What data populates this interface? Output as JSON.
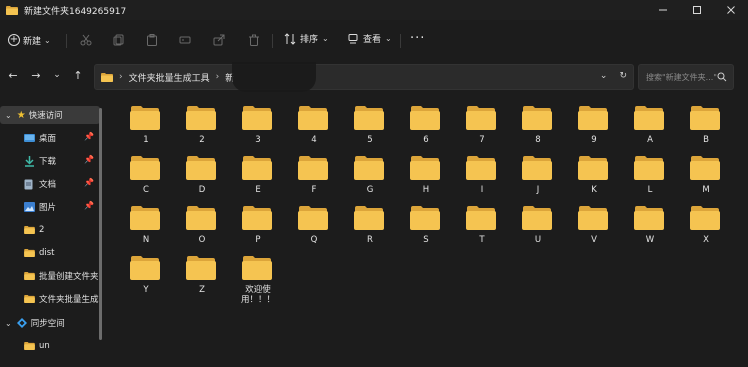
{
  "window": {
    "title": "新建文件夹1649265917",
    "controls": [
      "minimize",
      "maximize",
      "close"
    ]
  },
  "toolbar": {
    "new_label": "新建",
    "sort_label": "排序",
    "view_label": "查看",
    "more_label": "···",
    "icons": [
      "cut-icon",
      "copy-icon",
      "paste-icon",
      "rename-icon",
      "share-icon",
      "delete-icon"
    ]
  },
  "nav": {
    "back": "←",
    "forward": "→",
    "recent": "⌄",
    "up": "↑"
  },
  "address": {
    "segments": [
      "文件夹批量生成工具",
      "新"
    ],
    "refresh": "↻",
    "dropdown": "⌄"
  },
  "search": {
    "placeholder": "搜索\"新建文件夹...\""
  },
  "sidebar": {
    "quick_access": "快速访问",
    "items": [
      {
        "label": "桌面",
        "icon": "desktop-icon",
        "pinned": true
      },
      {
        "label": "下载",
        "icon": "download-icon",
        "pinned": true
      },
      {
        "label": "文档",
        "icon": "document-icon",
        "pinned": true
      },
      {
        "label": "图片",
        "icon": "picture-icon",
        "pinned": true
      },
      {
        "label": "2",
        "icon": "folder-icon",
        "pinned": false
      },
      {
        "label": "dist",
        "icon": "folder-icon",
        "pinned": false
      },
      {
        "label": "批量创建文件夹",
        "icon": "folder-icon",
        "pinned": false
      },
      {
        "label": "文件夹批量生成",
        "icon": "folder-icon",
        "pinned": false
      }
    ],
    "sync": "同步空间",
    "sync_items": [
      {
        "label": "un",
        "icon": "folder-icon"
      }
    ]
  },
  "folders": [
    "1",
    "2",
    "3",
    "4",
    "5",
    "6",
    "7",
    "8",
    "9",
    "A",
    "B",
    "C",
    "D",
    "E",
    "F",
    "G",
    "H",
    "I",
    "J",
    "K",
    "L",
    "M",
    "N",
    "O",
    "P",
    "Q",
    "R",
    "S",
    "T",
    "U",
    "V",
    "W",
    "X",
    "Y",
    "Z",
    "欢迎使用！！！"
  ],
  "colors": {
    "background": "#1c1c1c",
    "folder": "#f5c451",
    "folder_back": "#dca53a"
  }
}
